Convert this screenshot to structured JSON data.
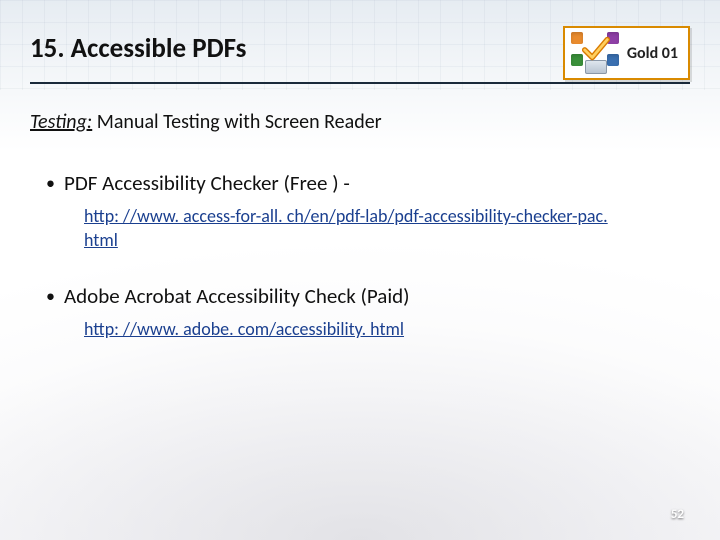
{
  "header": {
    "title": "15. Accessible PDFs",
    "badge_label": "Gold 01"
  },
  "subhead": {
    "label": "Testing:",
    "text": " Manual Testing with Screen Reader"
  },
  "bullets": [
    {
      "text": "PDF Accessibility Checker (Free ) -",
      "link": "http: //www. access-for-all. ch/en/pdf-lab/pdf-accessibility-checker-pac. html"
    },
    {
      "text": " Adobe Acrobat Accessibility Check (Paid)",
      "link": "http: //www. adobe. com/accessibility. html"
    }
  ],
  "page_number": "52"
}
